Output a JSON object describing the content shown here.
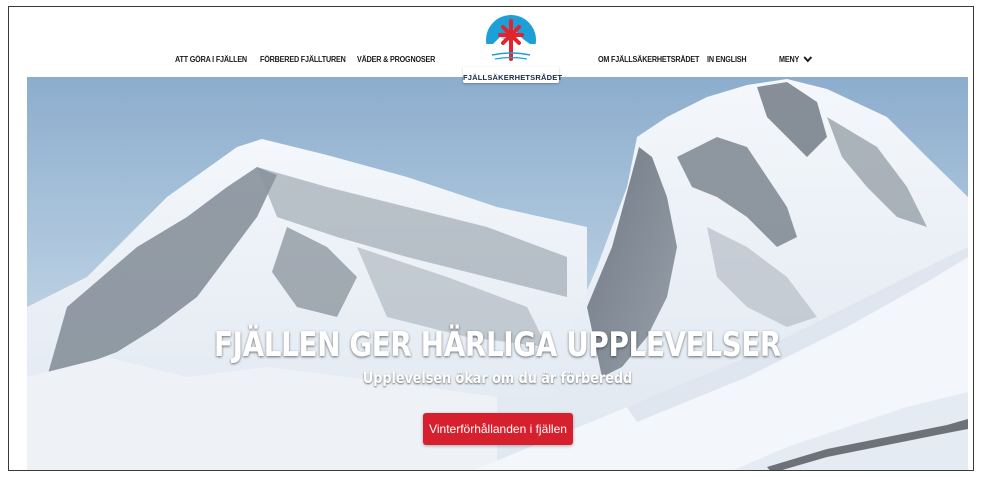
{
  "nav": {
    "left": [
      "ATT GÖRA I FJÄLLEN",
      "FÖRBERED FJÄLLTUREN",
      "VÄDER & PROGNOSER"
    ],
    "right": [
      "OM FJÄLLSÄKERHETSRÅDET",
      "IN ENGLISH",
      "MENY"
    ]
  },
  "logo": {
    "text": "FJÄLLSÄKERHETSRÅDET"
  },
  "hero": {
    "title": "FJÄLLEN GER HÄRLIGA UPPLEVELSER",
    "subtitle": "Upplevelsen ökar om du är förberedd",
    "cta_label": "Vinterförhållanden i fjällen"
  },
  "colors": {
    "accent": "#d6202e",
    "logo_blue": "#1da0d8",
    "logo_red": "#e0252f",
    "nav_text": "#1a1a1a"
  },
  "icons": {
    "menu": "chevron-down-icon",
    "logo": "mountain-cross-logo"
  }
}
